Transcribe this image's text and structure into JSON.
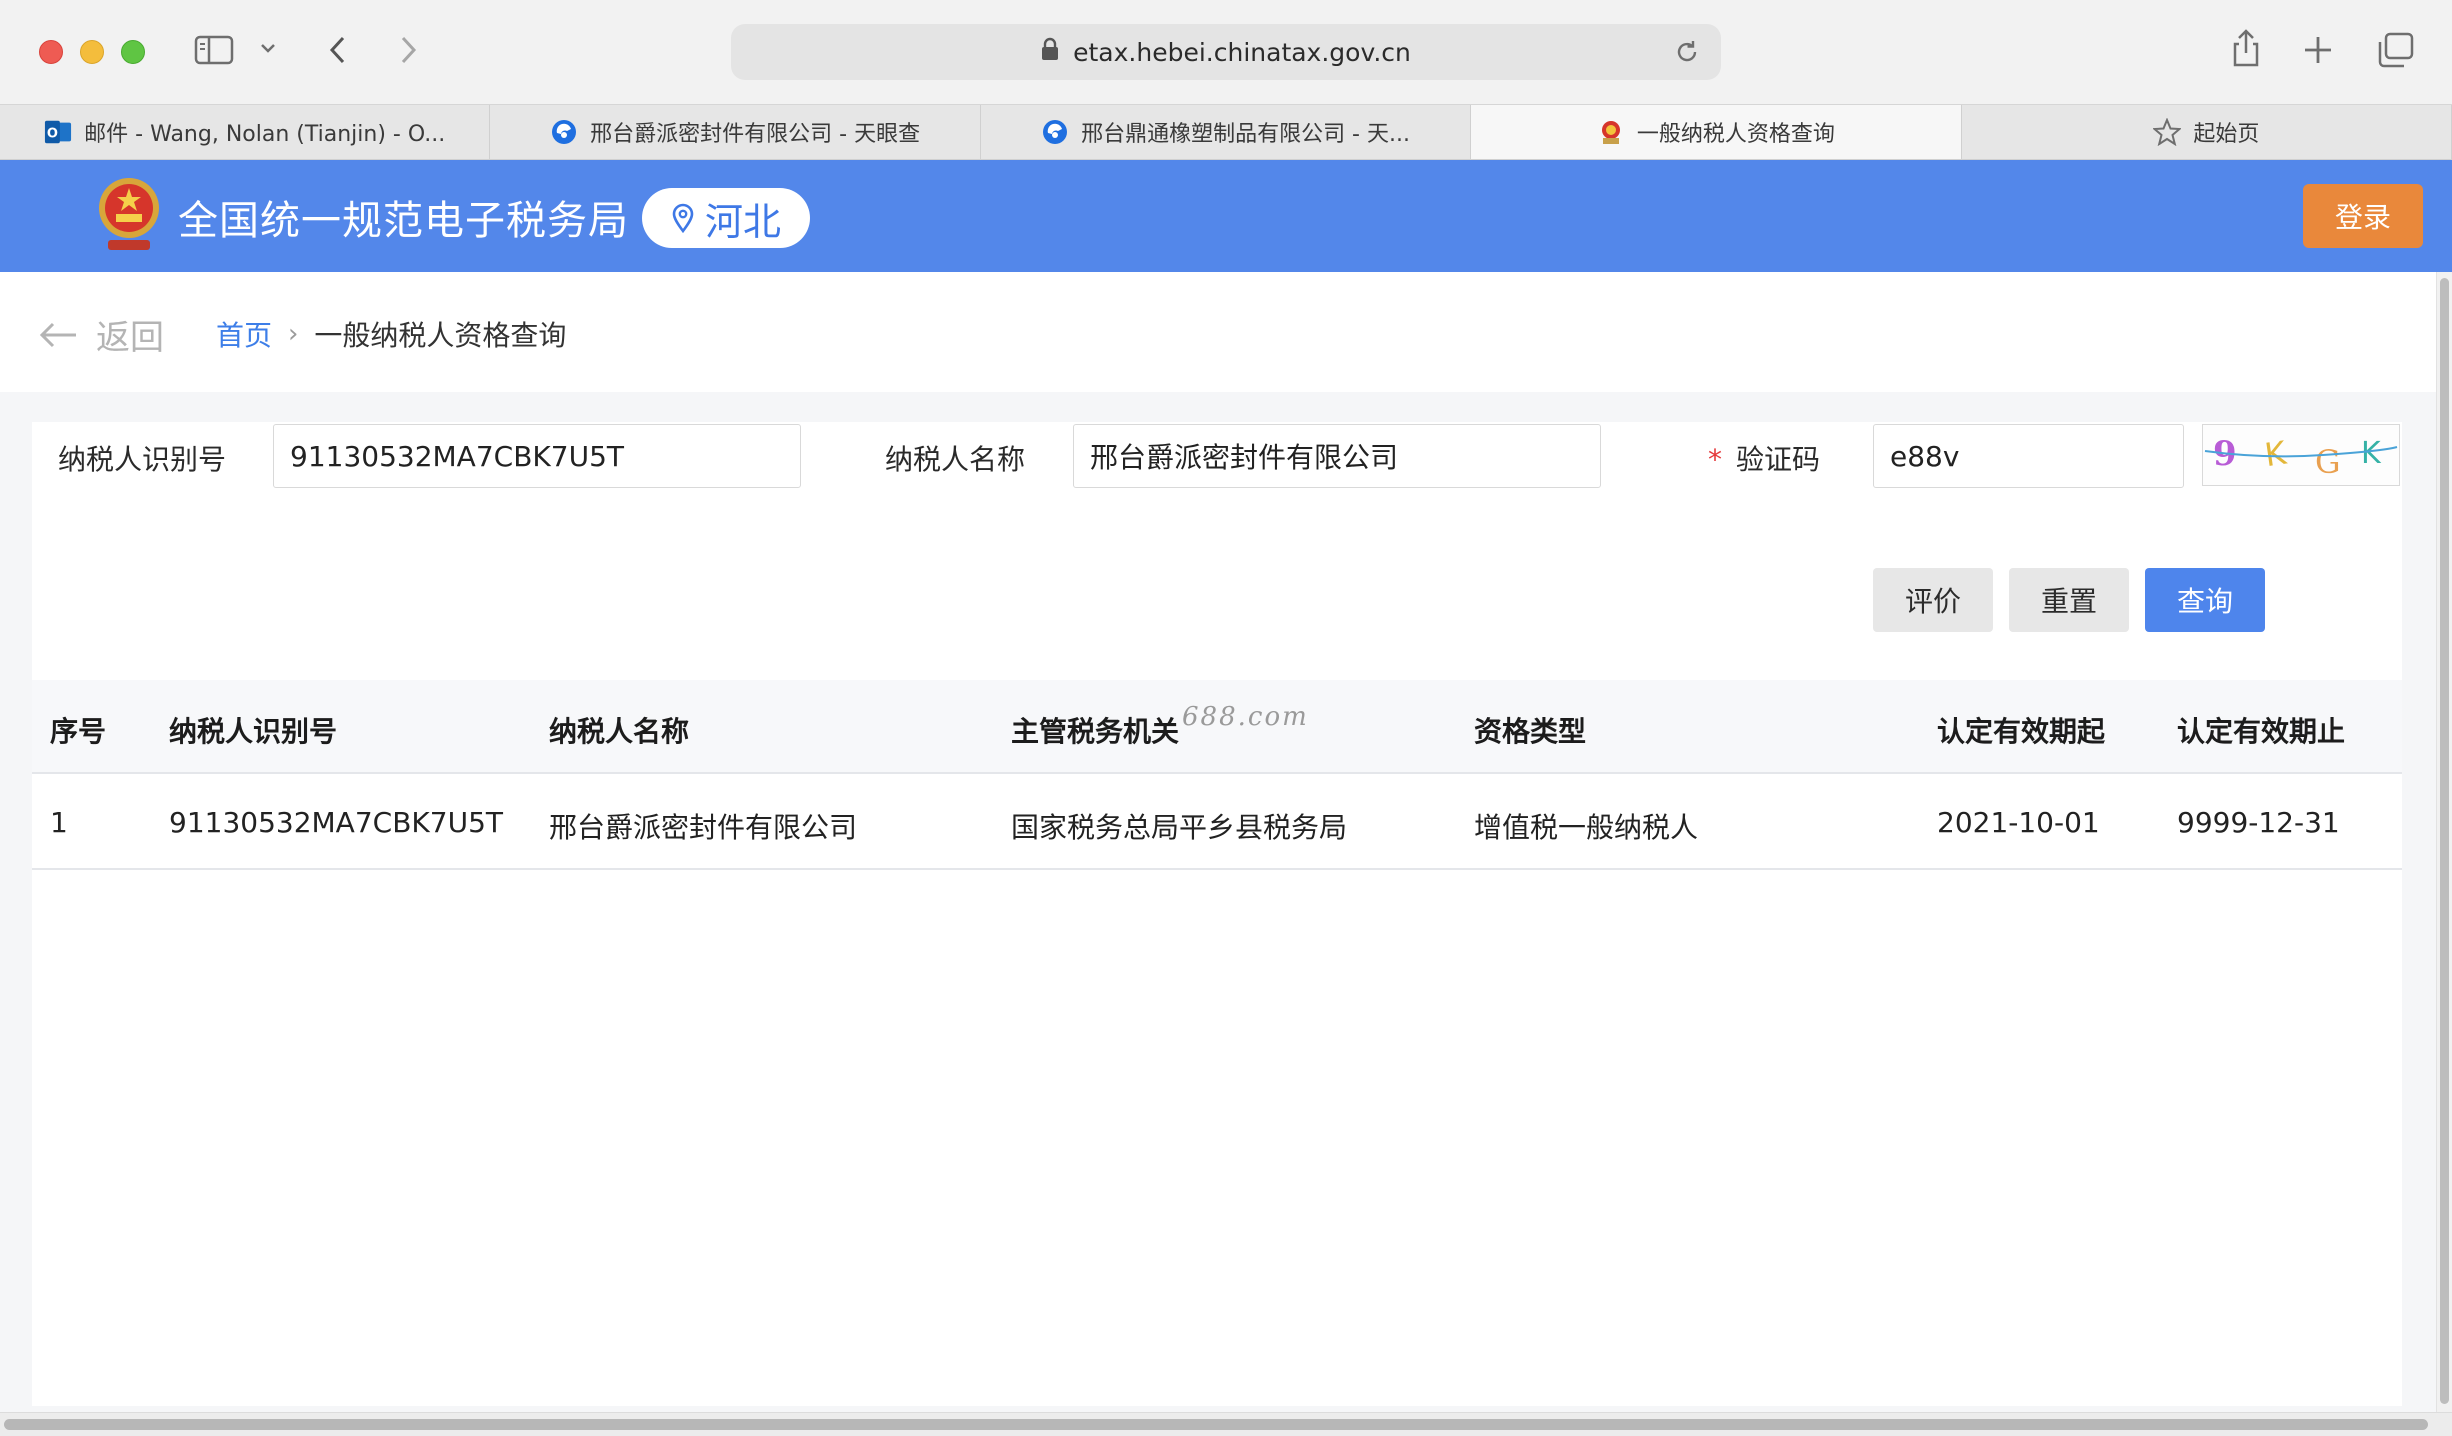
{
  "browser": {
    "url": "etax.hebei.chinatax.gov.cn",
    "tabs": [
      {
        "label": "邮件 - Wang, Nolan (Tianjin) - O...",
        "icon": "outlook-icon",
        "active": false
      },
      {
        "label": "邢台爵派密封件有限公司 - 天眼查",
        "icon": "tianyancha-icon",
        "active": false
      },
      {
        "label": "邢台鼎通橡塑制品有限公司 - 天...",
        "icon": "tianyancha-icon",
        "active": false
      },
      {
        "label": "一般纳税人资格查询",
        "icon": "tax-emblem-icon",
        "active": true
      },
      {
        "label": "起始页",
        "icon": "star-icon",
        "active": false
      }
    ]
  },
  "header": {
    "site_title": "全国统一规范电子税务局",
    "region": "河北",
    "login_label": "登录",
    "brand_color": "#5387ea",
    "login_color": "#e9883b"
  },
  "nav": {
    "back_label": "返回",
    "breadcrumb_home": "首页",
    "breadcrumb_separator": "›",
    "breadcrumb_current": "一般纳税人资格查询"
  },
  "form": {
    "taxpayer_id_label": "纳税人识别号",
    "taxpayer_id_value": "91130532MA7CBK7U5T",
    "taxpayer_name_label": "纳税人名称",
    "taxpayer_name_value": "邢台爵派密封件有限公司",
    "captcha_required_mark": "*",
    "captcha_label": "验证码",
    "captcha_value": "e88v",
    "captcha_image_text": "9KGK",
    "buttons": {
      "evaluate": "评价",
      "reset": "重置",
      "query": "查询"
    }
  },
  "table": {
    "columns": [
      "序号",
      "纳税人识别号",
      "纳税人名称",
      "主管税务机关",
      "资格类型",
      "认定有效期起",
      "认定有效期止"
    ],
    "watermark": "688.com",
    "rows": [
      [
        "1",
        "91130532MA7CBK7U5T",
        "邢台爵派密封件有限公司",
        "国家税务总局平乡县税务局",
        "增值税一般纳税人",
        "2021-10-01",
        "9999-12-31"
      ]
    ]
  }
}
